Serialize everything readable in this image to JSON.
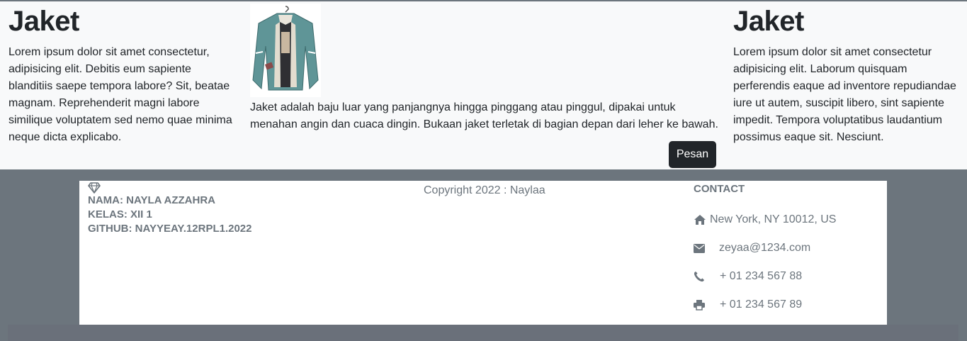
{
  "products": {
    "left": {
      "title": "Jaket",
      "description": "Lorem ipsum dolor sit amet consectetur, adipisicing elit. Debitis eum sapiente blanditiis saepe tempora labore? Sit, beatae magnam. Reprehenderit magni labore similique voluptatem sed nemo quae minima neque dicta explicabo."
    },
    "center": {
      "description": "Jaket adalah baju luar yang panjangnya hingga pinggang atau pinggul, dipakai untuk menahan angin dan cuaca dingin. Bukaan jaket terletak di bagian depan dari leher ke bawah.",
      "order_label": "Pesan"
    },
    "right": {
      "title": "Jaket",
      "description": "Lorem ipsum dolor sit amet consectetur adipisicing elit. Laborum quisquam perferendis eaque ad inventore repudiandae iure ut autem, suscipit libero, sint sapiente impedit. Tempora voluptatibus laudantium possimus eaque sit. Nesciunt."
    }
  },
  "footer": {
    "identity": {
      "icon": "gem-icon",
      "name": "NAMA: NAYLA AZZAHRA",
      "class": "KELAS: XII 1",
      "github": "GITHUB: NAYYEAY.12RPL1.2022"
    },
    "copyright": "Copyright 2022 : Naylaa",
    "contact": {
      "title": "CONTACT",
      "address": "New York, NY 10012, US",
      "email": "zeyaa@1234.com",
      "phone": "+ 01 234 567 88",
      "fax": "+ 01 234 567 89"
    }
  },
  "colors": {
    "page_bg": "#f8f9fa",
    "footer_bg": "#6c757d",
    "button_bg": "#212529",
    "muted_text": "#6c757d"
  }
}
